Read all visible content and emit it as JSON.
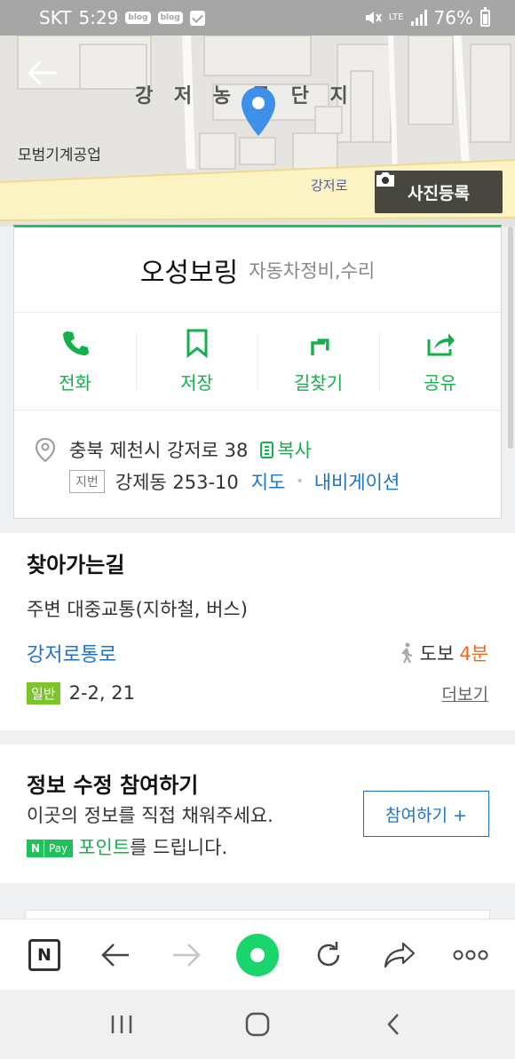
{
  "status_bar": {
    "carrier": "SKT",
    "time": "5:29",
    "notif_1": "blog",
    "notif_2": "blog",
    "network": "LTE",
    "battery": "76%"
  },
  "map": {
    "area_label": "강 저 농 공 단 지",
    "company_label": "모범기계공업",
    "road_label": "강저로",
    "photo_button": "사진등록"
  },
  "place": {
    "name": "오성보링",
    "category": "자동차정비,수리"
  },
  "actions": {
    "call": "전화",
    "save": "저장",
    "directions": "길찾기",
    "share": "공유"
  },
  "address": {
    "road": "충북 제천시 강저로 38",
    "copy": "복사",
    "jibun_tag": "지번",
    "jibun": "강제동 253-10",
    "map_link": "지도",
    "navi_link": "내비게이션"
  },
  "directions": {
    "title": "찾아가는길",
    "subtitle": "주변 대중교통(지하철, 버스)",
    "stop_name": "강저로통로",
    "walk_label": "도보",
    "walk_time": "4분",
    "bus_type": "일반",
    "bus_numbers": "2-2,  21",
    "more": "더보기"
  },
  "edit_info": {
    "title": "정보 수정 참여하기",
    "line1": "이곳의 정보를 직접 채워주세요.",
    "npay_n": "N",
    "npay_pay": "Pay",
    "points": "포인트",
    "line2_rest": "를 드립니다.",
    "button": "참여하기 +"
  },
  "toolbar": {
    "home_letter": "N"
  },
  "colors": {
    "green": "#13b04c",
    "link_blue": "#1f73c7",
    "orange": "#ef6a23",
    "pin_blue": "#3d8fe8"
  }
}
